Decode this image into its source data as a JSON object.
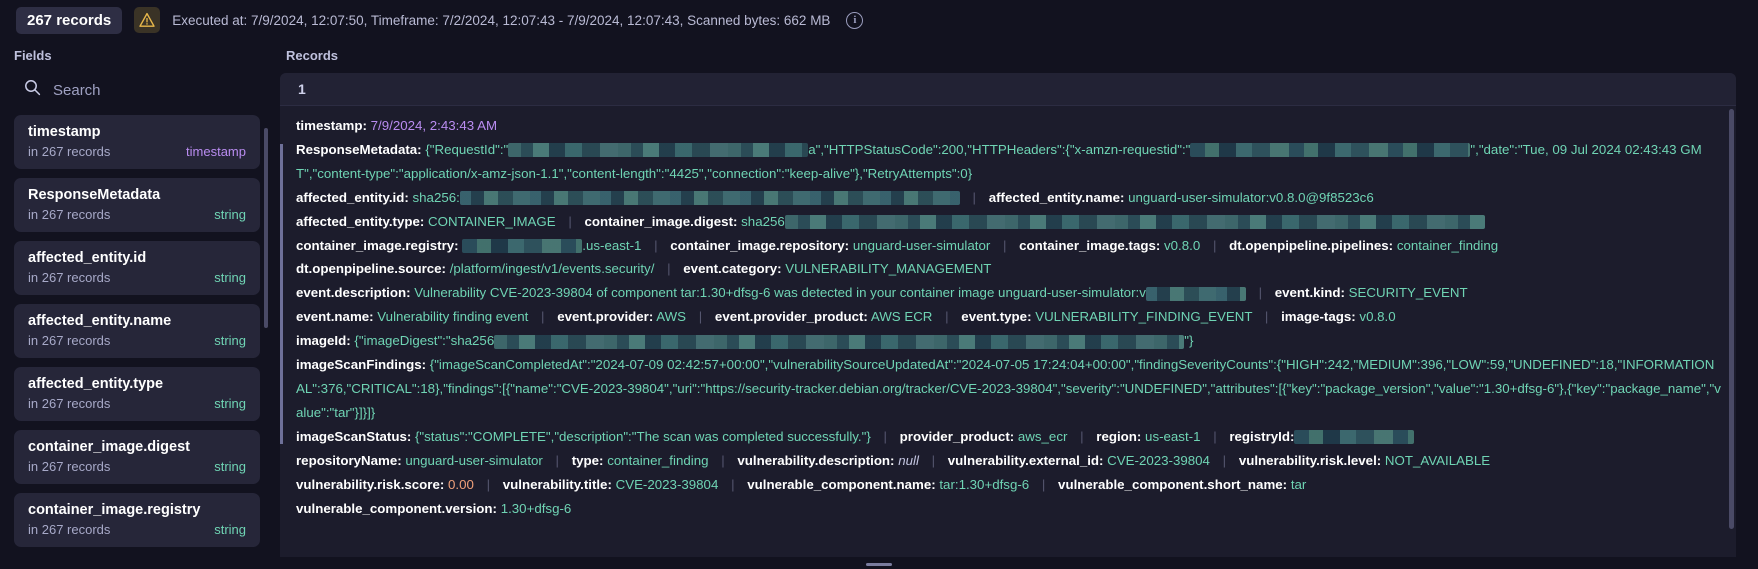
{
  "topbar": {
    "records_pill": "267 records",
    "warning_icon": "warning-triangle-icon",
    "exec_text": "Executed at: 7/9/2024, 12:07:50, Timeframe: 7/2/2024, 12:07:43 - 7/9/2024, 12:07:43, Scanned bytes: 662 MB",
    "info_icon": "i"
  },
  "fields": {
    "title": "Fields",
    "search_placeholder": "Search",
    "search_value": "",
    "search_icon": "search-icon",
    "items": [
      {
        "name": "timestamp",
        "count": "in 267 records",
        "type": "timestamp"
      },
      {
        "name": "ResponseMetadata",
        "count": "in 267 records",
        "type": "string"
      },
      {
        "name": "affected_entity.id",
        "count": "in 267 records",
        "type": "string"
      },
      {
        "name": "affected_entity.name",
        "count": "in 267 records",
        "type": "string"
      },
      {
        "name": "affected_entity.type",
        "count": "in 267 records",
        "type": "string"
      },
      {
        "name": "container_image.digest",
        "count": "in 267 records",
        "type": "string"
      },
      {
        "name": "container_image.registry",
        "count": "in 267 records",
        "type": "string"
      }
    ]
  },
  "records": {
    "title": "Records",
    "index": "1",
    "entry": {
      "timestamp_key": "timestamp:",
      "timestamp_value": "7/9/2024, 2:43:43 AM",
      "response_metadata_key": "ResponseMetadata:",
      "response_metadata_part1": "{\"RequestId\":\"",
      "response_metadata_part2": "a\",\"HTTPStatusCode\":200,\"HTTPHeaders\":{\"x-amzn-requestid\":\"",
      "response_metadata_part3": "\",\"date\":\"Tue, 09 Jul 2024 02:43:43 GMT\",\"content-type\":\"application/x-amz-json-1.1\",\"content-length\":\"4425\",\"connection\":\"keep-alive\"},\"RetryAttempts\":0}",
      "affected_entity_id_key": "affected_entity.id:",
      "affected_entity_id_value": "sha256:",
      "affected_entity_name_key": "affected_entity.name:",
      "affected_entity_name_value": "unguard-user-simulator:v0.8.0@9f8523c6",
      "affected_entity_type_key": "affected_entity.type:",
      "affected_entity_type_value": "CONTAINER_IMAGE",
      "container_image_digest_key": "container_image.digest:",
      "container_image_digest_value": "sha256",
      "container_image_registry_key": "container_image.registry:",
      "container_image_registry_value": ".us-east-1",
      "container_image_repository_key": "container_image.repository:",
      "container_image_repository_value": "unguard-user-simulator",
      "container_image_tags_key": "container_image.tags:",
      "container_image_tags_value": "v0.8.0",
      "dt_pipelines_key": "dt.openpipeline.pipelines:",
      "dt_pipelines_value": "container_finding",
      "dt_source_key": "dt.openpipeline.source:",
      "dt_source_value": "/platform/ingest/v1/events.security/",
      "event_category_key": "event.category:",
      "event_category_value": "VULNERABILITY_MANAGEMENT",
      "event_description_key": "event.description:",
      "event_description_value": "Vulnerability CVE-2023-39804 of component tar:1.30+dfsg-6 was detected in your container image unguard-user-simulator:v",
      "event_kind_key": "event.kind:",
      "event_kind_value": "SECURITY_EVENT",
      "event_name_key": "event.name:",
      "event_name_value": "Vulnerability finding event",
      "event_provider_key": "event.provider:",
      "event_provider_value": "AWS",
      "event_provider_product_key": "event.provider_product:",
      "event_provider_product_value": "AWS ECR",
      "event_type_key": "event.type:",
      "event_type_value": "VULNERABILITY_FINDING_EVENT",
      "image_tags_key": "image-tags:",
      "image_tags_value": "v0.8.0",
      "image_id_key": "imageId:",
      "image_id_part1": "{\"imageDigest\":\"sha256",
      "image_id_part2": "\"}",
      "image_scan_findings_key": "imageScanFindings:",
      "image_scan_findings_value": "{\"imageScanCompletedAt\":\"2024-07-09 02:42:57+00:00\",\"vulnerabilitySourceUpdatedAt\":\"2024-07-05 17:24:04+00:00\",\"findingSeverityCounts\":{\"HIGH\":242,\"MEDIUM\":396,\"LOW\":59,\"UNDEFINED\":18,\"INFORMATIONAL\":376,\"CRITICAL\":18},\"findings\":[{\"name\":\"CVE-2023-39804\",\"uri\":\"https://security-tracker.debian.org/tracker/CVE-2023-39804\",\"severity\":\"UNDEFINED\",\"attributes\":[{\"key\":\"package_version\",\"value\":\"1.30+dfsg-6\"},{\"key\":\"package_name\",\"value\":\"tar\"}]}]}",
      "image_scan_status_key": "imageScanStatus:",
      "image_scan_status_value": "{\"status\":\"COMPLETE\",\"description\":\"The scan was completed successfully.\"}",
      "provider_product_key": "provider_product:",
      "provider_product_value": "aws_ecr",
      "region_key": "region:",
      "region_value": "us-east-1",
      "registry_id_key": "registryId:",
      "repository_name_key": "repositoryName:",
      "repository_name_value": "unguard-user-simulator",
      "type_key": "type:",
      "type_value": "container_finding",
      "vuln_description_key": "vulnerability.description:",
      "vuln_description_value": "null",
      "vuln_external_id_key": "vulnerability.external_id:",
      "vuln_external_id_value": "CVE-2023-39804",
      "vuln_risk_level_key": "vulnerability.risk.level:",
      "vuln_risk_level_value": "NOT_AVAILABLE",
      "vuln_risk_score_key": "vulnerability.risk.score:",
      "vuln_risk_score_value": "0.00",
      "vuln_title_key": "vulnerability.title:",
      "vuln_title_value": "CVE-2023-39804",
      "vuln_component_name_key": "vulnerable_component.name:",
      "vuln_component_name_value": "tar:1.30+dfsg-6",
      "vuln_component_short_key": "vulnerable_component.short_name:",
      "vuln_component_short_value": "tar",
      "vuln_component_version_key": "vulnerable_component.version:",
      "vuln_component_version_value": "1.30+dfsg-6"
    }
  },
  "colors": {
    "background": "#12121f",
    "panel": "#1c1c2c",
    "card": "#262639",
    "string": "#6fd4b4",
    "timestamp": "#b98cf0",
    "number": "#f0a07a",
    "warning": "#e8b84b"
  }
}
